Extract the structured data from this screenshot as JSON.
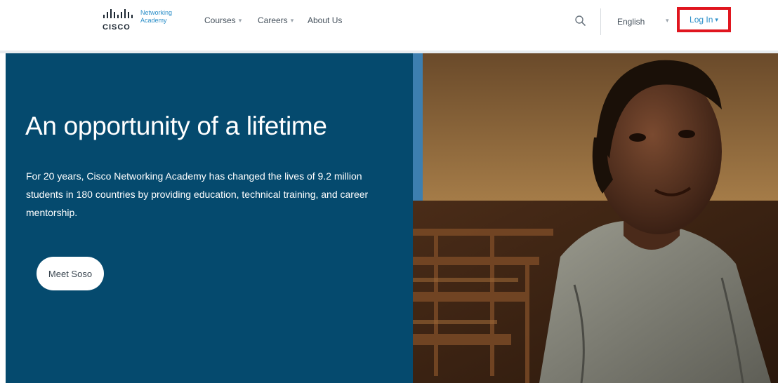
{
  "header": {
    "logo": {
      "brand": "CISCO",
      "product_line1": "Networking",
      "product_line2": "Academy"
    },
    "nav": [
      {
        "label": "Courses",
        "has_dropdown": true
      },
      {
        "label": "Careers",
        "has_dropdown": true
      },
      {
        "label": "About Us",
        "has_dropdown": false
      }
    ],
    "search_icon": "search-icon",
    "language": "English",
    "login_label": "Log In",
    "login_highlight_color": "#e0161f"
  },
  "hero": {
    "title": "An opportunity of a lifetime",
    "body": "For 20 years, Cisco Networking Academy has changed the lives of 9.2 million students in 180 countries by providing education, technical training, and career mentorship.",
    "button_label": "Meet Soso",
    "panel_color": "#054a6e"
  },
  "colors": {
    "accent_blue": "#2a8ec8",
    "text_dark": "#45515c"
  }
}
